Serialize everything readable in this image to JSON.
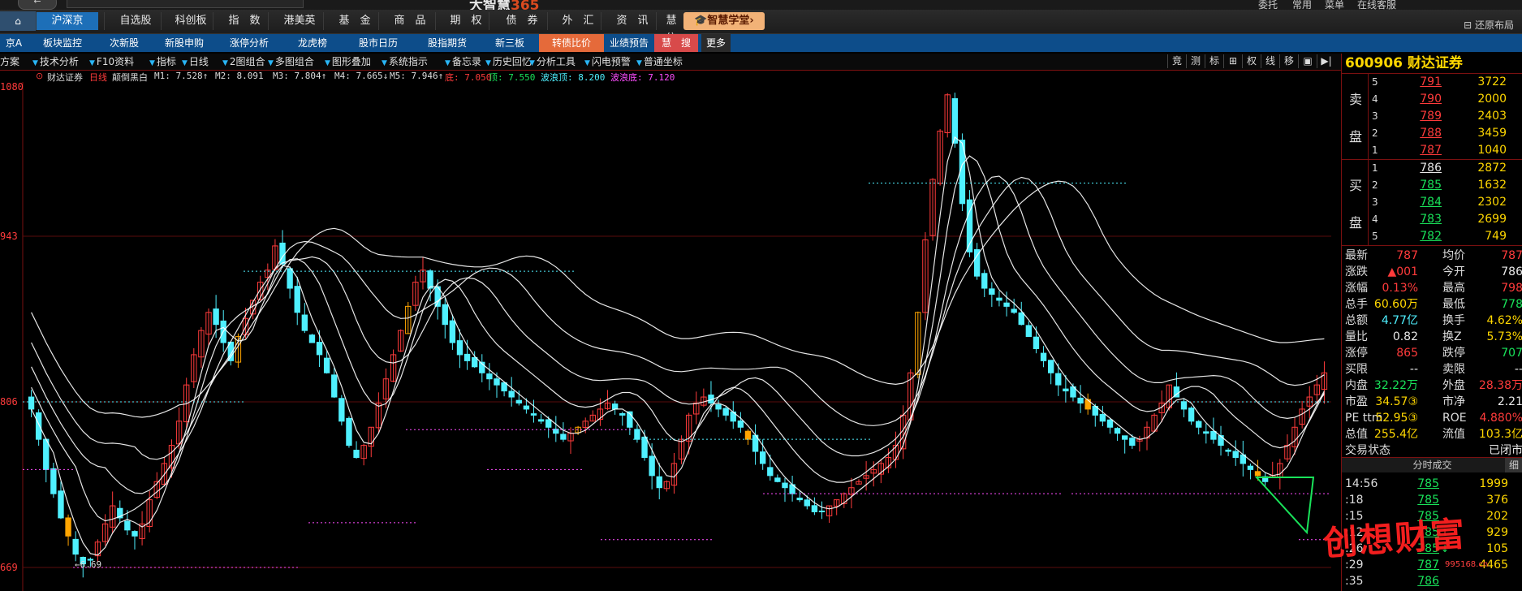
{
  "titlebar": {
    "back_label": "←",
    "app_title": "大智慧",
    "app_title_num": "365",
    "right_items": [
      "委托",
      "常用",
      "菜单",
      "在线客服"
    ]
  },
  "nav1": {
    "home": "⌂",
    "items": [
      {
        "label": "沪深京",
        "active": true
      },
      {
        "label": "自选股"
      },
      {
        "label": "科创板"
      },
      {
        "label": "指　数"
      },
      {
        "label": "港美英"
      },
      {
        "label": "基　金"
      },
      {
        "label": "商　品"
      },
      {
        "label": "期　权"
      },
      {
        "label": "债　券"
      },
      {
        "label": "外　汇"
      },
      {
        "label": "资　讯"
      },
      {
        "label": "慧　信"
      }
    ],
    "school": "🎓智慧学堂›",
    "restore": "还原布局"
  },
  "nav2": {
    "items": [
      {
        "label": "京A"
      },
      {
        "label": "板块监控"
      },
      {
        "label": "次新股"
      },
      {
        "label": "新股申购"
      },
      {
        "label": "涨停分析"
      },
      {
        "label": "龙虎榜"
      },
      {
        "label": "股市日历"
      },
      {
        "label": "股指期货"
      },
      {
        "label": "新三板"
      },
      {
        "label": "转债比价",
        "hl": 1
      },
      {
        "label": "业绩预告"
      },
      {
        "label": "慧　搜",
        "hl": 2
      },
      {
        "label": "更多",
        "hl": 3
      }
    ]
  },
  "toolbar": {
    "items": [
      "方案",
      "技术分析",
      "F10资料",
      "指标",
      "日线",
      "2图组合",
      "多图组合",
      "图形叠加",
      "系统指示",
      "备忘录",
      "历史回忆",
      "分析工具",
      "闪电预警",
      "普通坐标"
    ],
    "right_items": [
      "竞",
      "测",
      "标",
      "⊞",
      "权",
      "线",
      "移",
      "▣",
      "▶|"
    ]
  },
  "indicator": {
    "stock": "财达证券",
    "period": "日线",
    "mode": "颠倒黑白",
    "ma": [
      "M1: 7.528↑",
      "M2: 8.091",
      "M3: 7.804↑",
      "M4: 7.665↓",
      "M5: 7.946↑"
    ],
    "low": "底: 7.050",
    "top": "顶: 7.550",
    "wave_top": "波浪顶: 8.200",
    "wave_bottom": "波浪底: 7.120"
  },
  "chart_data": {
    "type": "candlestick",
    "price_labels": [
      "1080",
      "943",
      "806",
      "669"
    ],
    "price_levels": [
      10.8,
      9.43,
      8.06,
      6.69
    ],
    "annotations": [
      "10.80",
      "6.69"
    ],
    "ylim": [
      6.69,
      10.8
    ],
    "high_point": 10.8,
    "low_point": 6.69,
    "closes": [
      8.0,
      7.75,
      7.5,
      7.3,
      7.1,
      6.95,
      6.8,
      6.72,
      6.75,
      6.9,
      7.05,
      7.2,
      7.1,
      7.0,
      6.95,
      7.05,
      7.25,
      7.4,
      7.55,
      7.7,
      7.9,
      8.2,
      8.45,
      8.65,
      8.8,
      8.7,
      8.55,
      8.4,
      8.6,
      8.75,
      8.9,
      9.05,
      9.15,
      9.35,
      9.2,
      9.0,
      8.8,
      8.65,
      8.55,
      8.45,
      8.3,
      8.1,
      7.9,
      7.7,
      7.6,
      7.7,
      7.85,
      8.05,
      8.25,
      8.45,
      8.65,
      8.85,
      9.05,
      9.15,
      9.0,
      8.85,
      8.7,
      8.55,
      8.45,
      8.4,
      8.35,
      8.3,
      8.25,
      8.2,
      8.15,
      8.1,
      8.05,
      8.0,
      7.95,
      7.9,
      7.85,
      7.8,
      7.75,
      7.8,
      7.85,
      7.9,
      7.95,
      8.0,
      8.05,
      8.0,
      7.95,
      7.85,
      7.75,
      7.6,
      7.45,
      7.35,
      7.4,
      7.55,
      7.75,
      7.95,
      8.05,
      8.1,
      8.05,
      8.0,
      7.95,
      7.9,
      7.85,
      7.75,
      7.65,
      7.55,
      7.45,
      7.4,
      7.35,
      7.3,
      7.25,
      7.2,
      7.15,
      7.15,
      7.2,
      7.25,
      7.3,
      7.35,
      7.4,
      7.45,
      7.5,
      7.55,
      7.6,
      7.7,
      7.95,
      8.3,
      8.8,
      9.4,
      9.9,
      10.3,
      10.6,
      10.2,
      9.7,
      9.3,
      9.1,
      9.0,
      8.95,
      8.9,
      8.85,
      8.8,
      8.7,
      8.6,
      8.5,
      8.4,
      8.3,
      8.2,
      8.15,
      8.1,
      8.05,
      8.0,
      7.95,
      7.9,
      7.85,
      7.8,
      7.75,
      7.7,
      7.75,
      7.85,
      7.95,
      8.05,
      8.2,
      8.1,
      8.0,
      7.9,
      7.85,
      7.8,
      7.75,
      7.7,
      7.65,
      7.6,
      7.55,
      7.5,
      7.45,
      7.4,
      7.45,
      7.55,
      7.7,
      7.85,
      8.0,
      8.1,
      8.2,
      8.3
    ]
  },
  "quote": {
    "code": "600906",
    "name": "财达证券",
    "asks": [
      {
        "level": "5",
        "price": "791",
        "vol": "3722"
      },
      {
        "level": "4",
        "price": "790",
        "vol": "2000"
      },
      {
        "level": "3",
        "price": "789",
        "vol": "2403"
      },
      {
        "level": "2",
        "price": "788",
        "vol": "3459"
      },
      {
        "level": "1",
        "price": "787",
        "vol": "1040"
      }
    ],
    "bids": [
      {
        "level": "1",
        "price": "786",
        "vol": "2872"
      },
      {
        "level": "2",
        "price": "785",
        "vol": "1632"
      },
      {
        "level": "3",
        "price": "784",
        "vol": "2302"
      },
      {
        "level": "4",
        "price": "783",
        "vol": "2699"
      },
      {
        "level": "5",
        "price": "782",
        "vol": "749"
      }
    ],
    "ask_label": [
      "卖",
      "盘"
    ],
    "bid_label": [
      "买",
      "盘"
    ],
    "stats": [
      {
        "k": "最新",
        "v": "787",
        "vc": "red",
        "k2": "均价",
        "v2": "787",
        "v2c": "red"
      },
      {
        "k": "涨跌",
        "v": "▲001",
        "vc": "red",
        "k2": "今开",
        "v2": "786",
        "v2c": "wht"
      },
      {
        "k": "涨幅",
        "v": "0.13%",
        "vc": "red",
        "k2": "最高",
        "v2": "798",
        "v2c": "red"
      },
      {
        "k": "总手",
        "v": "60.60万",
        "vc": "yel",
        "k2": "最低",
        "v2": "778",
        "v2c": "grn"
      },
      {
        "k": "总额",
        "v": "4.77亿",
        "vc": "cyan",
        "k2": "换手",
        "v2": "4.62%",
        "v2c": "yel"
      },
      {
        "k": "量比",
        "v": "0.82",
        "vc": "wht",
        "k2": "换Z",
        "v2": "5.73%",
        "v2c": "yel"
      },
      {
        "k": "涨停",
        "v": "865",
        "vc": "red",
        "k2": "跌停",
        "v2": "707",
        "v2c": "grn"
      },
      {
        "k": "买限",
        "v": "--",
        "vc": "wht",
        "k2": "卖限",
        "v2": "--",
        "v2c": "wht"
      },
      {
        "k": "内盘",
        "v": "32.22万",
        "vc": "grn",
        "k2": "外盘",
        "v2": "28.38万",
        "v2c": "red"
      },
      {
        "k": "市盈",
        "v": "34.57③",
        "vc": "yel",
        "k2": "市净",
        "v2": "2.21",
        "v2c": "wht"
      },
      {
        "k": "PE ttm",
        "v": "52.95③",
        "vc": "yel",
        "k2": "ROE",
        "v2": "4.880%",
        "v2c": "red"
      },
      {
        "k": "总值",
        "v": "255.4亿",
        "vc": "yel",
        "k2": "流值",
        "v2": "103.3亿",
        "v2c": "yel"
      },
      {
        "k": "交易状态",
        "v": "",
        "vc": "wht",
        "k2": "",
        "v2": "已闭市",
        "v2c": "wht"
      }
    ],
    "ticks_header": "分时成交",
    "ticks_detail": "细",
    "ticks": [
      {
        "t": "14:56",
        "p": "785",
        "q": "1999",
        "ar": ""
      },
      {
        "t": ":18",
        "p": "785",
        "q": "376",
        "ar": ""
      },
      {
        "t": ":15",
        "p": "785",
        "q": "202",
        "ar": ""
      },
      {
        "t": ":12",
        "p": "785",
        "q": "929",
        "ar": "↑"
      },
      {
        "t": ":26",
        "p": "785",
        "q": "105",
        "ar": "↓"
      },
      {
        "t": ":29",
        "p": "787",
        "q": "4465",
        "ar": ""
      },
      {
        "t": ":35",
        "p": "786",
        "q": "",
        "ar": ""
      }
    ]
  },
  "watermark": {
    "text": "创想财富",
    "sub": "995168.cn"
  },
  "colors": {
    "up": "#ff3b3b",
    "down": "#4ff0ff",
    "ma": "#ffffff",
    "grid": "#7a1010",
    "accent": "#1d6fb8"
  }
}
